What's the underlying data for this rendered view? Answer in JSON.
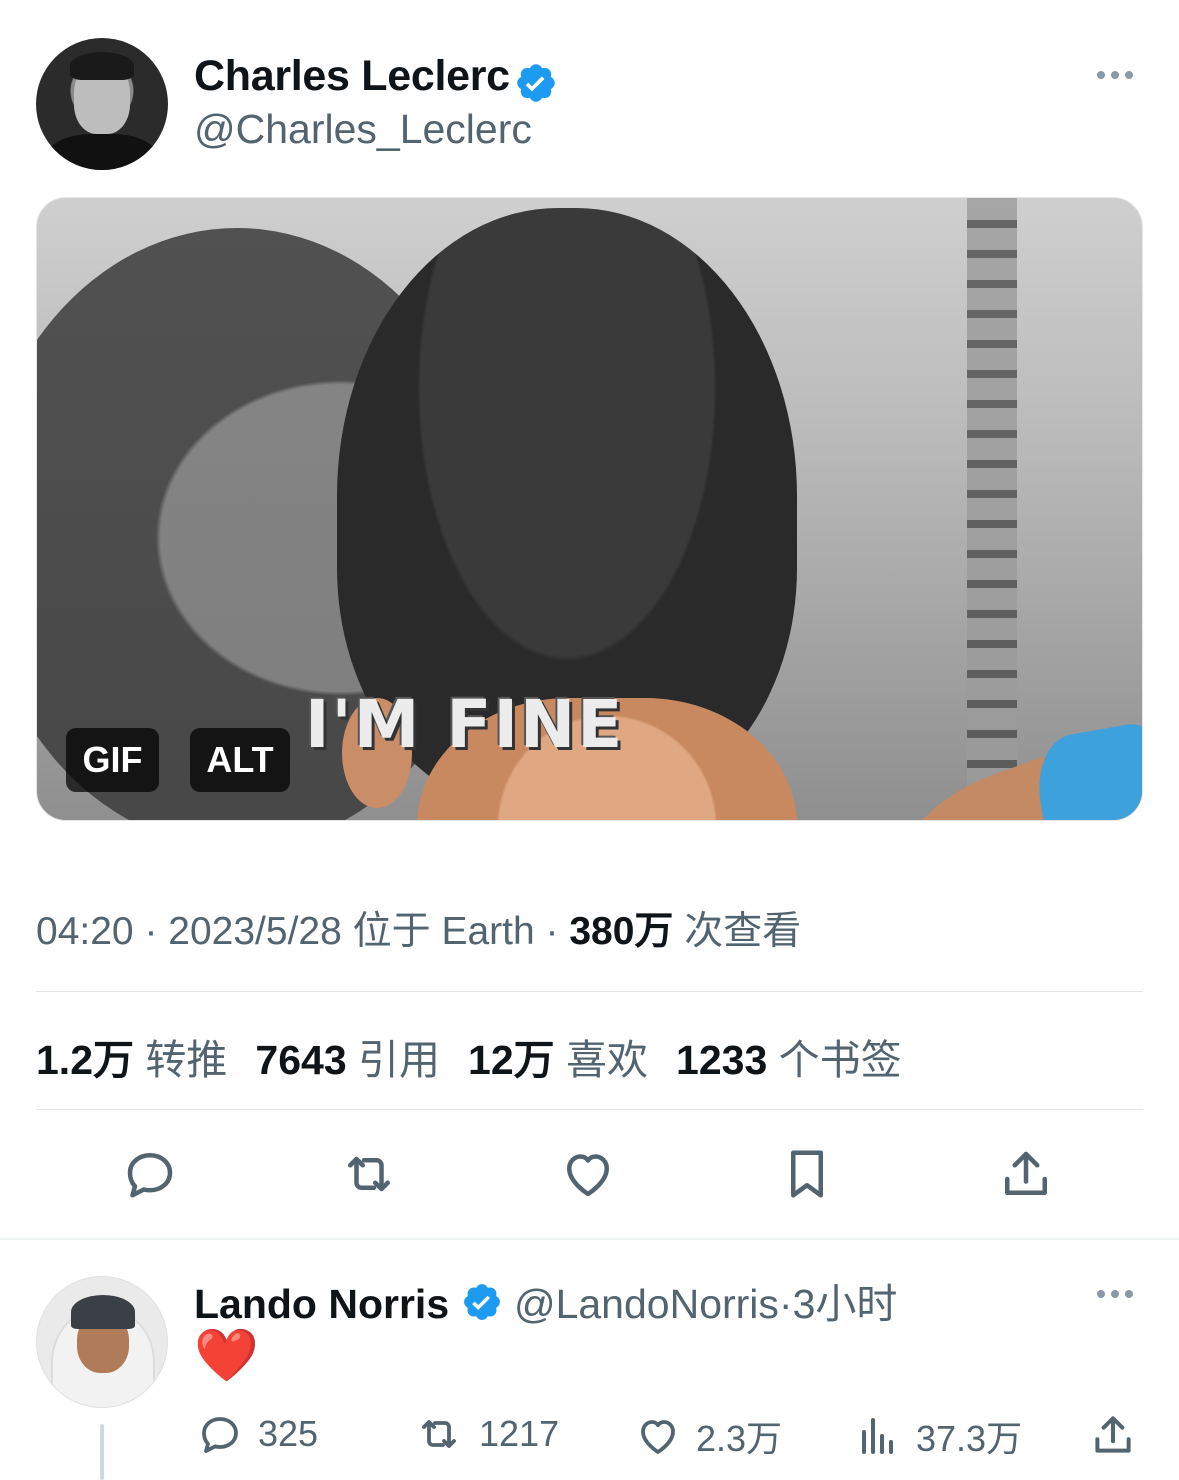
{
  "tweet": {
    "author_name": "Charles Leclerc",
    "author_handle": "@Charles_Leclerc",
    "media": {
      "caption": "I'M FINE",
      "gif_badge": "GIF",
      "alt_badge": "ALT"
    },
    "meta": {
      "time": "04:20",
      "dot1": " · ",
      "date": "2023/5/28",
      "location": " 位于 Earth",
      "dot2": " · ",
      "views_count": "380万",
      "views_label": " 次查看"
    },
    "stats": [
      {
        "value": "1.2万",
        "label": "转推"
      },
      {
        "value": "7643",
        "label": "引用"
      },
      {
        "value": "12万",
        "label": "喜欢"
      },
      {
        "value": "1233",
        "label": "个书签"
      }
    ],
    "actions": [
      "reply-icon",
      "retweet-icon",
      "like-icon",
      "bookmark-icon",
      "share-icon"
    ]
  },
  "reply": {
    "author_name": "Lando Norris",
    "author_handle": "@LandoNorris",
    "separator": "·",
    "time": "3小时",
    "body": "❤️",
    "actions": {
      "replies": "325",
      "retweets": "1217",
      "likes": "2.3万",
      "views": "37.3万"
    }
  },
  "colors": {
    "verified": "#1d9bf0",
    "secondary_text": "#536471",
    "primary_text": "#0f1419",
    "divider": "#e3e6e8"
  }
}
